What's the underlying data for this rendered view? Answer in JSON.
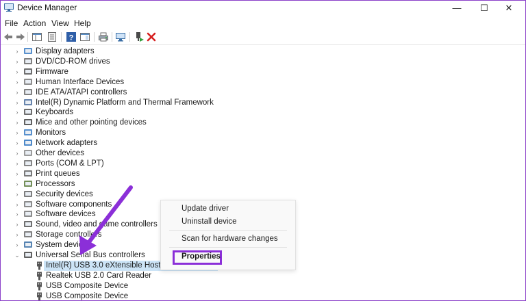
{
  "window": {
    "title": "Device Manager",
    "controls": {
      "minimize": "—",
      "maximize": "☐",
      "close": "✕"
    }
  },
  "menu": [
    "File",
    "Action",
    "View",
    "Help"
  ],
  "toolbar_icons": [
    "back-icon",
    "forward-icon",
    "show-hide-console-tree-icon",
    "properties-icon",
    "help-icon",
    "action-pane-icon",
    "print-icon",
    "scan-hardware-icon",
    "enable-device-icon",
    "uninstall-device-icon"
  ],
  "tree": {
    "categories": [
      {
        "label": "Display adapters",
        "icon": "display-adapter-icon",
        "expanded": false
      },
      {
        "label": "DVD/CD-ROM drives",
        "icon": "dvd-drive-icon",
        "expanded": false
      },
      {
        "label": "Firmware",
        "icon": "firmware-icon",
        "expanded": false
      },
      {
        "label": "Human Interface Devices",
        "icon": "hid-icon",
        "expanded": false
      },
      {
        "label": "IDE ATA/ATAPI controllers",
        "icon": "ide-controller-icon",
        "expanded": false
      },
      {
        "label": "Intel(R) Dynamic Platform and Thermal Framework",
        "icon": "thermal-framework-icon",
        "expanded": false
      },
      {
        "label": "Keyboards",
        "icon": "keyboard-icon",
        "expanded": false
      },
      {
        "label": "Mice and other pointing devices",
        "icon": "mouse-icon",
        "expanded": false
      },
      {
        "label": "Monitors",
        "icon": "monitor-icon",
        "expanded": false
      },
      {
        "label": "Network adapters",
        "icon": "network-adapter-icon",
        "expanded": false
      },
      {
        "label": "Other devices",
        "icon": "other-devices-icon",
        "expanded": false
      },
      {
        "label": "Ports (COM & LPT)",
        "icon": "ports-icon",
        "expanded": false
      },
      {
        "label": "Print queues",
        "icon": "print-queue-icon",
        "expanded": false
      },
      {
        "label": "Processors",
        "icon": "processor-icon",
        "expanded": false
      },
      {
        "label": "Security devices",
        "icon": "security-device-icon",
        "expanded": false
      },
      {
        "label": "Software components",
        "icon": "software-component-icon",
        "expanded": false
      },
      {
        "label": "Software devices",
        "icon": "software-device-icon",
        "expanded": false
      },
      {
        "label": "Sound, video and game controllers",
        "icon": "sound-icon",
        "expanded": false
      },
      {
        "label": "Storage controllers",
        "icon": "storage-controller-icon",
        "expanded": false
      },
      {
        "label": "System devices",
        "icon": "system-devices-icon",
        "expanded": false
      },
      {
        "label": "Universal Serial Bus controllers",
        "icon": "usb-icon",
        "expanded": true
      }
    ],
    "usb_children": [
      {
        "label": "Intel(R) USB 3.0 eXtensible Host Controller - 1.0 (Microsoft)",
        "selected": true
      },
      {
        "label": "Realtek USB 2.0 Card Reader",
        "selected": false
      },
      {
        "label": "USB Composite Device",
        "selected": false
      },
      {
        "label": "USB Composite Device",
        "selected": false
      }
    ]
  },
  "context_menu": {
    "items": [
      "Update driver",
      "Uninstall device",
      "Scan for hardware changes",
      "Properties"
    ],
    "highlighted": "Properties"
  },
  "colors": {
    "frame_border": "#8a3fc8",
    "annotation_purple": "#8b2fd8",
    "selection": "#cce4f7"
  }
}
